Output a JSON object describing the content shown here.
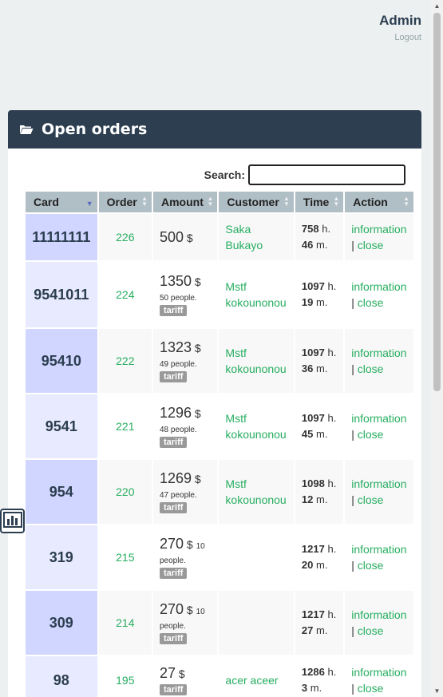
{
  "header": {
    "user_name": "Admin",
    "logout_label": "Logout"
  },
  "panel": {
    "title": "Open orders",
    "search_label": "Search:",
    "search_value": ""
  },
  "table": {
    "columns": [
      "Card",
      "Order",
      "Amount",
      "Customer",
      "Time",
      "Action"
    ],
    "rows": [
      {
        "card": "11111111",
        "order": "226",
        "amount": "500",
        "currency": "$",
        "people": "",
        "tariff": "",
        "customer": "Saka Bukayo",
        "time_h": "758",
        "time_m": "46",
        "action_info": "information",
        "action_sep": "|",
        "action_close": "close"
      },
      {
        "card": "9541011",
        "order": "224",
        "amount": "1350",
        "currency": "$",
        "people": "50 people.",
        "tariff": "tariff",
        "customer": "Mstf kokounonou",
        "time_h": "1097",
        "time_m": "19",
        "action_info": "information",
        "action_sep": "|",
        "action_close": "close"
      },
      {
        "card": "95410",
        "order": "222",
        "amount": "1323",
        "currency": "$",
        "people": "49 people.",
        "tariff": "tariff",
        "customer": "Mstf kokounonou",
        "time_h": "1097",
        "time_m": "36",
        "action_info": "information",
        "action_sep": "|",
        "action_close": "close"
      },
      {
        "card": "9541",
        "order": "221",
        "amount": "1296",
        "currency": "$",
        "people": "48 people.",
        "tariff": "tariff",
        "customer": "Mstf kokounonou",
        "time_h": "1097",
        "time_m": "45",
        "action_info": "information",
        "action_sep": "|",
        "action_close": "close"
      },
      {
        "card": "954",
        "order": "220",
        "amount": "1269",
        "currency": "$",
        "people": "47 people.",
        "tariff": "tariff",
        "customer": "Mstf kokounonou",
        "time_h": "1098",
        "time_m": "12",
        "action_info": "information",
        "action_sep": "|",
        "action_close": "close"
      },
      {
        "card": "319",
        "order": "215",
        "amount": "270",
        "currency": "$",
        "people": "10 people.",
        "tariff": "tariff",
        "customer": "",
        "time_h": "1217",
        "time_m": "20",
        "action_info": "information",
        "action_sep": "|",
        "action_close": "close"
      },
      {
        "card": "309",
        "order": "214",
        "amount": "270",
        "currency": "$",
        "people": "10 people.",
        "tariff": "tariff",
        "customer": "",
        "time_h": "1217",
        "time_m": "27",
        "action_info": "information",
        "action_sep": "|",
        "action_close": "close"
      },
      {
        "card": "98",
        "order": "195",
        "amount": "27",
        "currency": "$",
        "people": "",
        "tariff": "tariff",
        "customer": "acer aceer",
        "time_h": "1286",
        "time_m": "3",
        "action_info": "information",
        "action_sep": "|",
        "action_close": "close"
      }
    ],
    "time_h_unit": "h.",
    "time_m_unit": "m."
  },
  "icons": {
    "panel_icon": "folder-open-icon",
    "side_widget": "bar-chart-icon"
  },
  "colors": {
    "header_bg": "#2c3e50",
    "link": "#27ae60",
    "card_odd": "#d0d6ff",
    "card_even": "#e8eaff",
    "th_bg": "#b0bec5"
  }
}
